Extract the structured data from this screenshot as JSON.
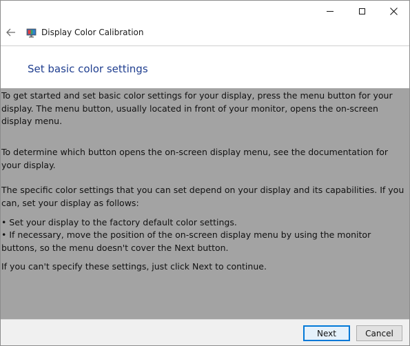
{
  "window": {
    "title": "Display Color Calibration"
  },
  "caption_buttons": {
    "minimize": "minimize-icon",
    "maximize": "maximize-icon",
    "close": "close-icon"
  },
  "nav": {
    "back_icon": "back-arrow-icon",
    "app_icon": "display-calibration-icon"
  },
  "page": {
    "heading": "Set basic color settings",
    "paragraphs": {
      "p1": "To get started and set basic color settings for your display, press the menu button for your display. The menu button, usually located in front of your monitor, opens the on-screen display menu.",
      "p2": "To determine which button opens the on-screen display menu, see the documentation for your display.",
      "p3": "The specific color settings that you can set depend on your display and its capabilities. If you can, set your display as follows:",
      "bullet1": "• Set your display to the factory default color settings.",
      "bullet2": "• If necessary, move the position of the on-screen display menu by using the monitor buttons, so the menu doesn't cover the Next button.",
      "p4": "If you can't specify these settings,  just click Next to continue."
    }
  },
  "footer": {
    "next_label": "Next",
    "cancel_label": "Cancel"
  },
  "colors": {
    "heading": "#1f3e8f",
    "body_overlay": "#a3a3a3",
    "default_button_border": "#0078d7"
  }
}
